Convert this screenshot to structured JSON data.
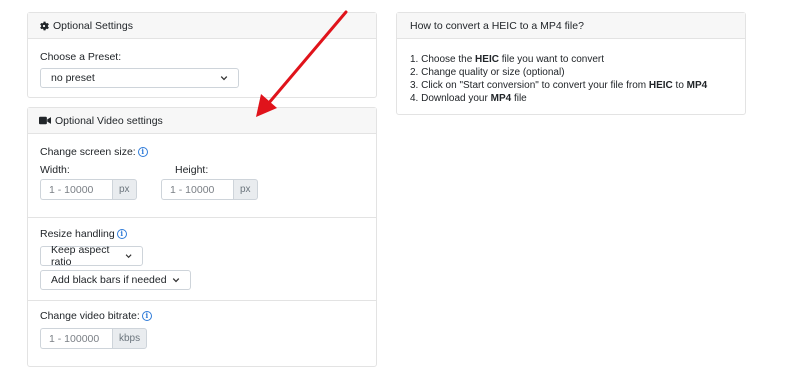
{
  "optional_settings": {
    "title": "Optional Settings",
    "preset_label": "Choose a Preset:",
    "preset_value": "no preset"
  },
  "video_settings": {
    "title": "Optional Video settings",
    "screen_size_label": "Change screen size:",
    "width_label": "Width:",
    "width_placeholder": "1 - 10000",
    "width_unit": "px",
    "height_label": "Height:",
    "height_placeholder": "1 - 10000",
    "height_unit": "px",
    "resize_label": "Resize handling",
    "resize_mode": "Keep aspect ratio",
    "resize_fill": "Add black bars if needed",
    "bitrate_label": "Change video bitrate:",
    "bitrate_placeholder": "1 - 100000",
    "bitrate_unit": "kbps"
  },
  "howto": {
    "title": "How to convert a HEIC to a MP4 file?",
    "steps": [
      [
        "1. Choose the ",
        "HEIC",
        " file you want to convert",
        "",
        ""
      ],
      [
        "2. Change quality or size (optional)",
        "",
        "",
        "",
        ""
      ],
      [
        "3. Click on \"Start conversion\" to convert your file from ",
        "HEIC",
        " to ",
        "MP4",
        ""
      ],
      [
        "4. Download your ",
        "MP4",
        " file",
        "",
        ""
      ]
    ]
  },
  "icons": {
    "settings": "gear-icon",
    "video": "video-camera-icon",
    "info": "info-icon",
    "dropdown": "chevron-down-icon",
    "annotation": "red-arrow"
  },
  "colors": {
    "accent": "#2f7bd8",
    "annotation_arrow": "#e0131b",
    "header_bg": "#f7f7f7",
    "border": "#e3e3e3"
  }
}
